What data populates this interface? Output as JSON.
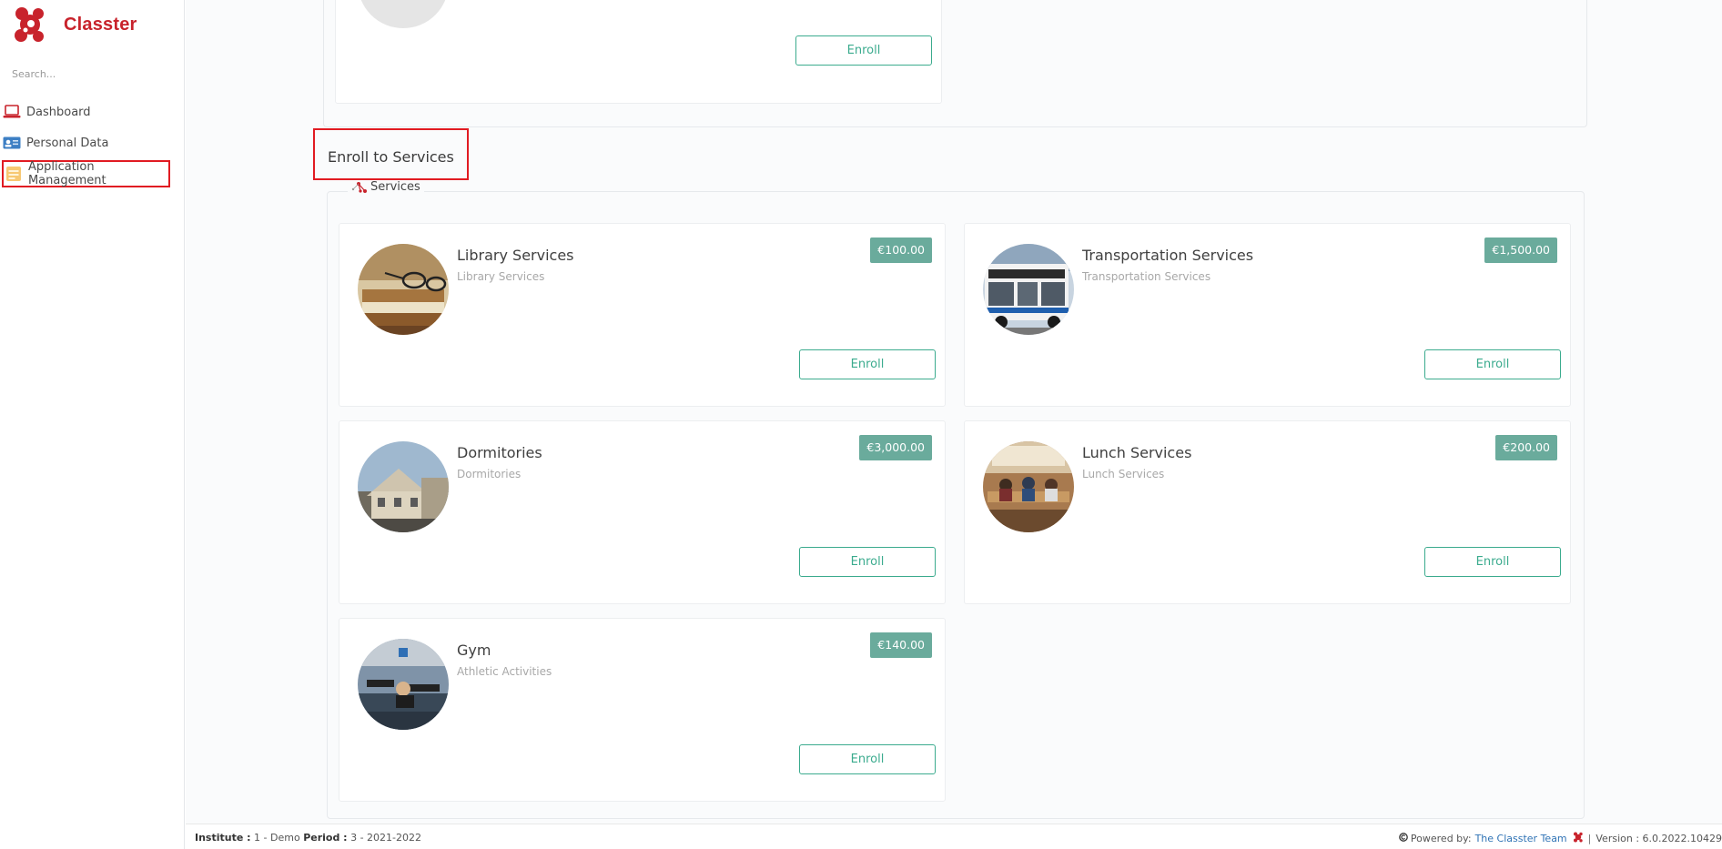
{
  "app": {
    "name": "Classter",
    "brand_color": "#c8232c"
  },
  "search": {
    "placeholder": "Search..."
  },
  "sidebar": {
    "items": [
      {
        "label": "Dashboard",
        "icon": "laptop-icon"
      },
      {
        "label": "Personal Data",
        "icon": "id-card-icon"
      },
      {
        "label": "Application Management",
        "icon": "folder-icon"
      }
    ]
  },
  "top_card": {
    "enroll_label": "Enroll"
  },
  "section": {
    "title": "Enroll to Services",
    "legend": "Services"
  },
  "services": [
    {
      "title": "Library Services",
      "subtitle": "Library Services",
      "price": "€100.00",
      "enroll_label": "Enroll"
    },
    {
      "title": "Transportation Services",
      "subtitle": "Transportation Services",
      "price": "€1,500.00",
      "enroll_label": "Enroll"
    },
    {
      "title": "Dormitories",
      "subtitle": "Dormitories",
      "price": "€3,000.00",
      "enroll_label": "Enroll"
    },
    {
      "title": "Lunch Services",
      "subtitle": "Lunch Services",
      "price": "€200.00",
      "enroll_label": "Enroll"
    },
    {
      "title": "Gym",
      "subtitle": "Athletic Activities",
      "price": "€140.00",
      "enroll_label": "Enroll"
    }
  ],
  "footer": {
    "institute_label": "Institute :",
    "institute_value": "1 - Demo",
    "period_label": "Period :",
    "period_value": "3 - 2021-2022",
    "powered_by": "Powered by:",
    "team": "The Classter Team",
    "version": "Version : 6.0.2022.10429"
  },
  "colors": {
    "accent": "#3bab8e",
    "price_badge": "#6aab9c",
    "highlight": "#e11b22"
  }
}
